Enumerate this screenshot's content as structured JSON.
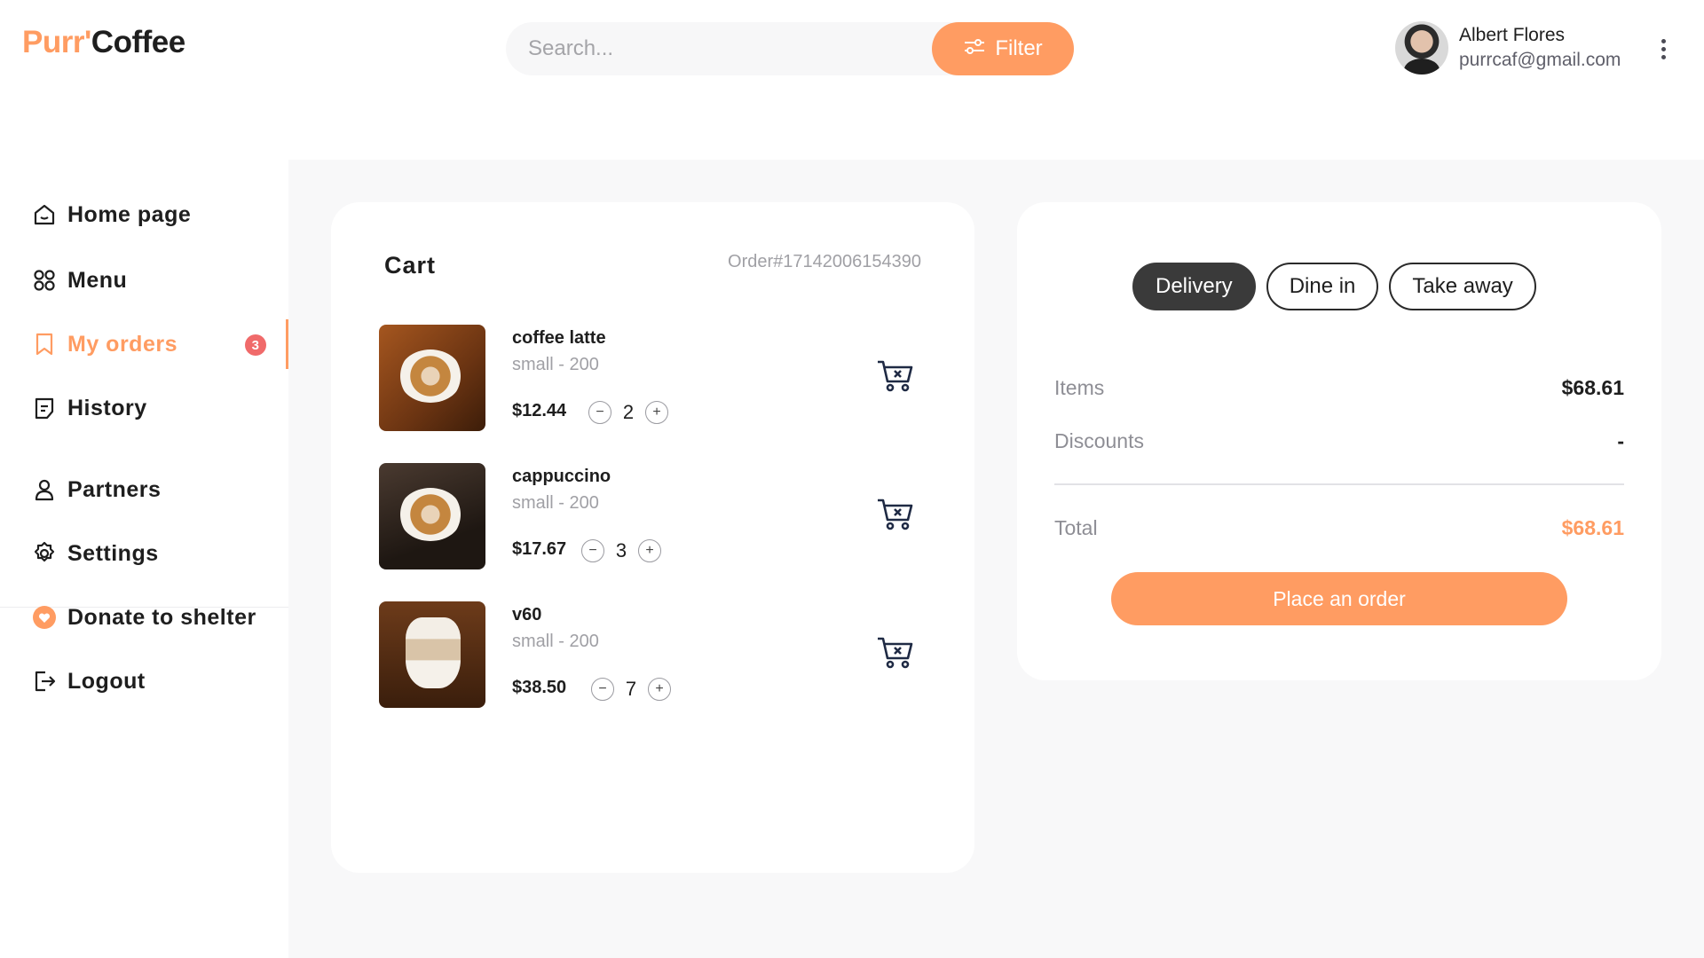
{
  "brand": {
    "part1": "Purr'",
    "part2": "Coffee"
  },
  "search": {
    "placeholder": "Search...",
    "filter_label": "Filter"
  },
  "user": {
    "name": "Albert Flores",
    "email": "purrcaf@gmail.com"
  },
  "sidebar": {
    "items": [
      {
        "label": "Home page",
        "icon": "home-icon"
      },
      {
        "label": "Menu",
        "icon": "grid-icon"
      },
      {
        "label": "My orders",
        "icon": "bookmark-icon",
        "badge": "3",
        "active": true
      },
      {
        "label": "History",
        "icon": "document-icon"
      },
      {
        "label": "Partners",
        "icon": "user-icon"
      },
      {
        "label": "Settings",
        "icon": "gear-icon"
      },
      {
        "label": "Donate to shelter",
        "icon": "heart-icon"
      },
      {
        "label": "Logout",
        "icon": "logout-icon"
      }
    ]
  },
  "cart": {
    "title": "Cart",
    "order_id": "Order#17142006154390",
    "items": [
      {
        "name": "coffee latte",
        "size": "small - 200",
        "price": "$12.44",
        "qty": "2"
      },
      {
        "name": "cappuccino",
        "size": "small - 200",
        "price": "$17.67",
        "qty": "3"
      },
      {
        "name": "v60",
        "size": "small - 200",
        "price": "$38.50",
        "qty": "7"
      }
    ]
  },
  "summary": {
    "tabs": [
      {
        "label": "Delivery",
        "active": true
      },
      {
        "label": "Dine in",
        "active": false
      },
      {
        "label": "Take away",
        "active": false
      }
    ],
    "items_label": "Items",
    "items_value": "$68.61",
    "discounts_label": "Discounts",
    "discounts_value": "-",
    "total_label": "Total",
    "total_value": "$68.61",
    "place_order": "Place an order"
  },
  "colors": {
    "accent": "#ff9c62",
    "badge": "#f06a6a",
    "dark": "#3a3a3a"
  }
}
